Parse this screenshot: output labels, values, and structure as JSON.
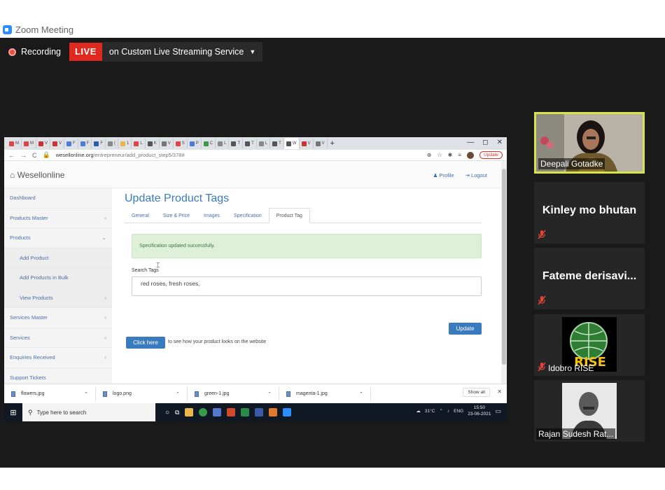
{
  "zoom": {
    "window_title": "Zoom Meeting",
    "recording_label": "Recording",
    "live_badge": "LIVE",
    "stream_label": "on Custom Live Streaming Service",
    "stream_caret": "▼"
  },
  "browser": {
    "tabs": [
      "M",
      "M",
      "V",
      "V",
      "F",
      "F",
      "F",
      "(",
      "1",
      "L",
      "K",
      "V",
      "S",
      "P",
      "C",
      "L",
      "T",
      "T",
      "L",
      "T",
      "W",
      "V",
      "V"
    ],
    "new_tab": "+",
    "window_controls": [
      "—",
      "◻",
      "✕"
    ],
    "address_domain": "wesellonline.org",
    "address_path": "/entrepreneur/add_product_step5/378#",
    "update_button": "Update"
  },
  "site": {
    "brand": "Wesellonline",
    "header_links": [
      "Profile",
      "Logout"
    ],
    "sidebar": [
      {
        "label": "Dashboard",
        "chevron": ""
      },
      {
        "label": "Products Master",
        "chevron": "‹"
      },
      {
        "label": "Products",
        "chevron": "⌄"
      },
      {
        "label": "Add Product",
        "chevron": "",
        "sub": true
      },
      {
        "label": "Add Products in Bulk",
        "chevron": "",
        "sub": true
      },
      {
        "label": "View Products",
        "chevron": "‹",
        "sub": true
      },
      {
        "label": "Services Master",
        "chevron": "‹"
      },
      {
        "label": "Services",
        "chevron": "‹"
      },
      {
        "label": "Enquiries Received",
        "chevron": "‹"
      },
      {
        "label": "Support Tickets",
        "chevron": ""
      }
    ],
    "page_title": "Update Product Tags",
    "tabs": [
      "General",
      "Size & Price",
      "Images",
      "Specification",
      "Product Tag"
    ],
    "active_tab": "Product Tag",
    "alert": "Specification updated successfully.",
    "search_label": "Search Tags",
    "tags_value": "red roses, fresh roses,",
    "update_button": "Update",
    "click_here": "Click here",
    "click_text": "to see how your product looks on the website"
  },
  "downloads": {
    "files": [
      "flowers.jpg",
      "logo.png",
      "green-1.jpg",
      "magenta-1.jpg"
    ],
    "show_all": "Show all",
    "close": "✕"
  },
  "taskbar": {
    "search_placeholder": "Type here to search",
    "temperature": "31°C",
    "language": "ENG",
    "time": "15:50",
    "date": "23-06-2021"
  },
  "participants": [
    {
      "name": "Deepali Gotadke",
      "type": "video"
    },
    {
      "name": "Kinley mo bhutan",
      "type": "name",
      "muted": true
    },
    {
      "name": "Fateme  derisavi...",
      "type": "name",
      "muted": true
    },
    {
      "name": "Idobro RISE",
      "type": "logo",
      "logo_text": "RISE",
      "muted": true
    },
    {
      "name": "Rajan Sudesh Rat...",
      "type": "video"
    }
  ],
  "colors": {
    "live_red": "#e02a1f",
    "active_speaker": "#d6e34a",
    "link_blue": "#3a7bbf",
    "success_bg": "#dff0d8"
  }
}
